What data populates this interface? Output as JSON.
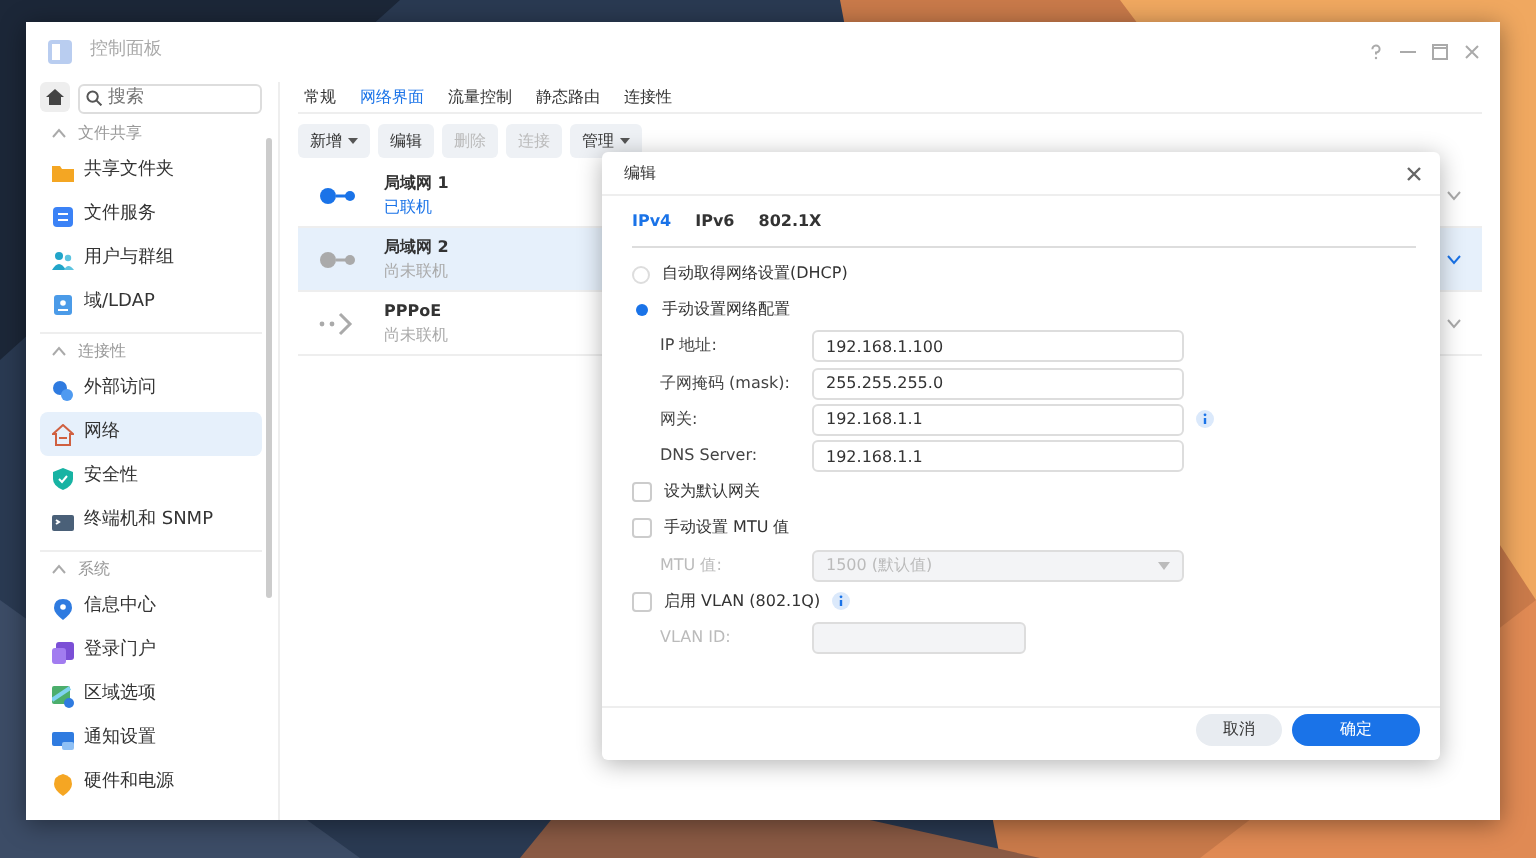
{
  "window": {
    "title": "控制面板"
  },
  "sidebar": {
    "search": {
      "placeholder": "搜索"
    },
    "sections": [
      {
        "title": "文件共享",
        "expanded": true,
        "items": [
          {
            "label": "共享文件夹",
            "selected": false
          },
          {
            "label": "文件服务",
            "selected": false
          },
          {
            "label": "用户与群组",
            "selected": false
          },
          {
            "label": "域/LDAP",
            "selected": false
          }
        ]
      },
      {
        "title": "连接性",
        "expanded": true,
        "items": [
          {
            "label": "外部访问",
            "selected": false
          },
          {
            "label": "网络",
            "selected": true
          },
          {
            "label": "安全性",
            "selected": false
          },
          {
            "label": "终端机和 SNMP",
            "selected": false
          }
        ]
      },
      {
        "title": "系统",
        "expanded": true,
        "items": [
          {
            "label": "信息中心",
            "selected": false
          },
          {
            "label": "登录门户",
            "selected": false
          },
          {
            "label": "区域选项",
            "selected": false
          },
          {
            "label": "通知设置",
            "selected": false
          },
          {
            "label": "硬件和电源",
            "selected": false
          }
        ]
      }
    ]
  },
  "tabs": [
    {
      "label": "常规",
      "selected": false
    },
    {
      "label": "网络界面",
      "selected": true
    },
    {
      "label": "流量控制",
      "selected": false
    },
    {
      "label": "静态路由",
      "selected": false
    },
    {
      "label": "连接性",
      "selected": false
    }
  ],
  "toolbar": [
    {
      "label": "新增",
      "dropdown": true,
      "disabled": false
    },
    {
      "label": "编辑",
      "dropdown": false,
      "disabled": false
    },
    {
      "label": "删除",
      "dropdown": false,
      "disabled": true
    },
    {
      "label": "连接",
      "dropdown": false,
      "disabled": true
    },
    {
      "label": "管理",
      "dropdown": true,
      "disabled": false
    }
  ],
  "interfaces": [
    {
      "kind": "lan",
      "name": "局域网 1",
      "status": "已联机",
      "connected": true,
      "selected": false
    },
    {
      "kind": "lan",
      "name": "局域网 2",
      "status": "尚未联机",
      "connected": false,
      "selected": true
    },
    {
      "kind": "pppoe",
      "name": "PPPoE",
      "status": "尚未联机",
      "connected": false,
      "selected": false
    }
  ],
  "dialog": {
    "title": "编辑",
    "tabs": [
      {
        "label": "IPv4",
        "selected": true
      },
      {
        "label": "IPv6",
        "selected": false
      },
      {
        "label": "802.1X",
        "selected": false
      }
    ],
    "options": [
      {
        "kind": "radio",
        "label": "自动取得网络设置(DHCP)",
        "checked": false
      },
      {
        "kind": "radio",
        "label": "手动设置网络配置",
        "checked": true
      },
      {
        "kind": "field",
        "label": "IP 地址:",
        "value": "192.168.1.100",
        "disabled": false,
        "info": false
      },
      {
        "kind": "field",
        "label": "子网掩码 (mask):",
        "value": "255.255.255.0",
        "disabled": false,
        "info": false
      },
      {
        "kind": "field",
        "label": "网关:",
        "value": "192.168.1.1",
        "disabled": false,
        "info": true
      },
      {
        "kind": "field",
        "label": "DNS Server:",
        "value": "192.168.1.1",
        "disabled": false,
        "info": false
      },
      {
        "kind": "checkbox",
        "label": "设为默认网关",
        "checked": false,
        "info": false
      },
      {
        "kind": "checkbox",
        "label": "手动设置 MTU 值",
        "checked": false,
        "info": false
      },
      {
        "kind": "select",
        "label": "MTU 值:",
        "value": "1500 (默认值)",
        "disabled": true
      },
      {
        "kind": "checkbox",
        "label": "启用 VLAN (802.1Q)",
        "checked": false,
        "info": true
      },
      {
        "kind": "field",
        "label": "VLAN ID:",
        "disabled": true,
        "info": false
      }
    ],
    "buttons": [
      {
        "label": "取消",
        "primary": false
      },
      {
        "label": "确定",
        "primary": true
      }
    ]
  }
}
